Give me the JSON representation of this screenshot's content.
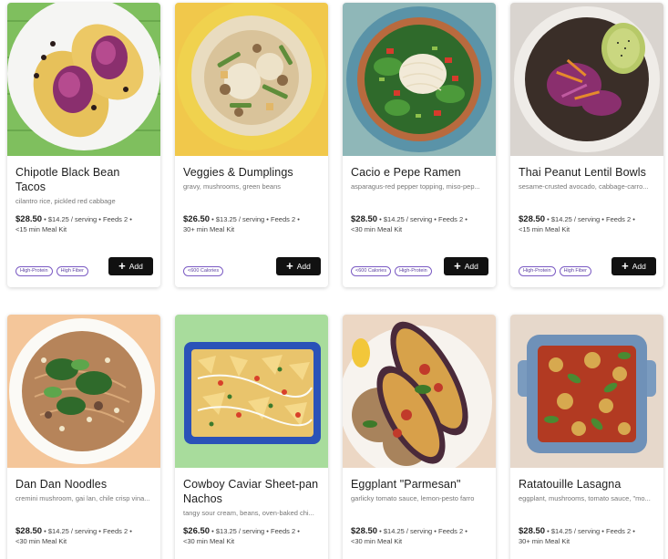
{
  "add_label": "Add",
  "cards": [
    {
      "title": "Chipotle Black Bean Tacos",
      "subtitle": "cilantro rice, pickled red cabbage",
      "price": "$28.50",
      "details_1": " • $14.25 / serving • Feeds 2 •",
      "details_2": "<15 min Meal Kit",
      "tags": [
        "High-Protein",
        "High Fiber"
      ],
      "image_icon": "tacos-photo",
      "bg_color": "#7fbf5e"
    },
    {
      "title": "Veggies & Dumplings",
      "subtitle": "gravy, mushrooms, green beans",
      "price": "$26.50",
      "details_1": " • $13.25 / serving • Feeds 2 •",
      "details_2": "30+ min Meal Kit",
      "tags": [
        "<600 Calories"
      ],
      "image_icon": "dumplings-photo",
      "bg_color": "#f1c84b"
    },
    {
      "title": "Cacio e Pepe Ramen",
      "subtitle": "asparagus-red pepper topping, miso-pep...",
      "price": "$28.50",
      "details_1": " • $14.25 / serving • Feeds 2 •",
      "details_2": "<30 min Meal Kit",
      "tags": [
        "<600 Calories",
        "High-Protein"
      ],
      "image_icon": "ramen-photo",
      "bg_color": "#8fb7b8"
    },
    {
      "title": "Thai Peanut Lentil Bowls",
      "subtitle": "sesame-crusted avocado, cabbage-carro...",
      "price": "$28.50",
      "details_1": " • $14.25 / serving • Feeds 2 •",
      "details_2": "<15 min Meal Kit",
      "tags": [
        "High-Protein",
        "High Fiber"
      ],
      "image_icon": "lentil-bowl-photo",
      "bg_color": "#d9d4cf"
    },
    {
      "title": "Dan Dan Noodles",
      "subtitle": "cremini mushroom, gai lan, chile crisp vina...",
      "price": "$28.50",
      "details_1": " • $14.25 / serving • Feeds 2 •",
      "details_2": "<30 min Meal Kit",
      "tags": [],
      "image_icon": "noodles-photo",
      "bg_color": "#f4c69a"
    },
    {
      "title": "Cowboy Caviar Sheet-pan Nachos",
      "subtitle": "tangy sour cream, beans, oven-baked chi...",
      "price": "$26.50",
      "details_1": " • $13.25 / serving • Feeds 2 •",
      "details_2": "<30 min Meal Kit",
      "tags": [],
      "image_icon": "nachos-photo",
      "bg_color": "#a8dc9c"
    },
    {
      "title": "Eggplant \"Parmesan\"",
      "subtitle": "garlicky tomato sauce, lemon-pesto farro",
      "price": "$28.50",
      "details_1": " • $14.25 / serving • Feeds 2 •",
      "details_2": "<30 min Meal Kit",
      "tags": [],
      "image_icon": "eggplant-photo",
      "bg_color": "#ecd7c4"
    },
    {
      "title": "Ratatouille Lasagna",
      "subtitle": "eggplant, mushrooms, tomato sauce, \"mo...",
      "price": "$28.50",
      "details_1": " • $14.25 / serving • Feeds 2 •",
      "details_2": "30+ min Meal Kit",
      "tags": [],
      "image_icon": "lasagna-photo",
      "bg_color": "#e6d8cb"
    }
  ]
}
